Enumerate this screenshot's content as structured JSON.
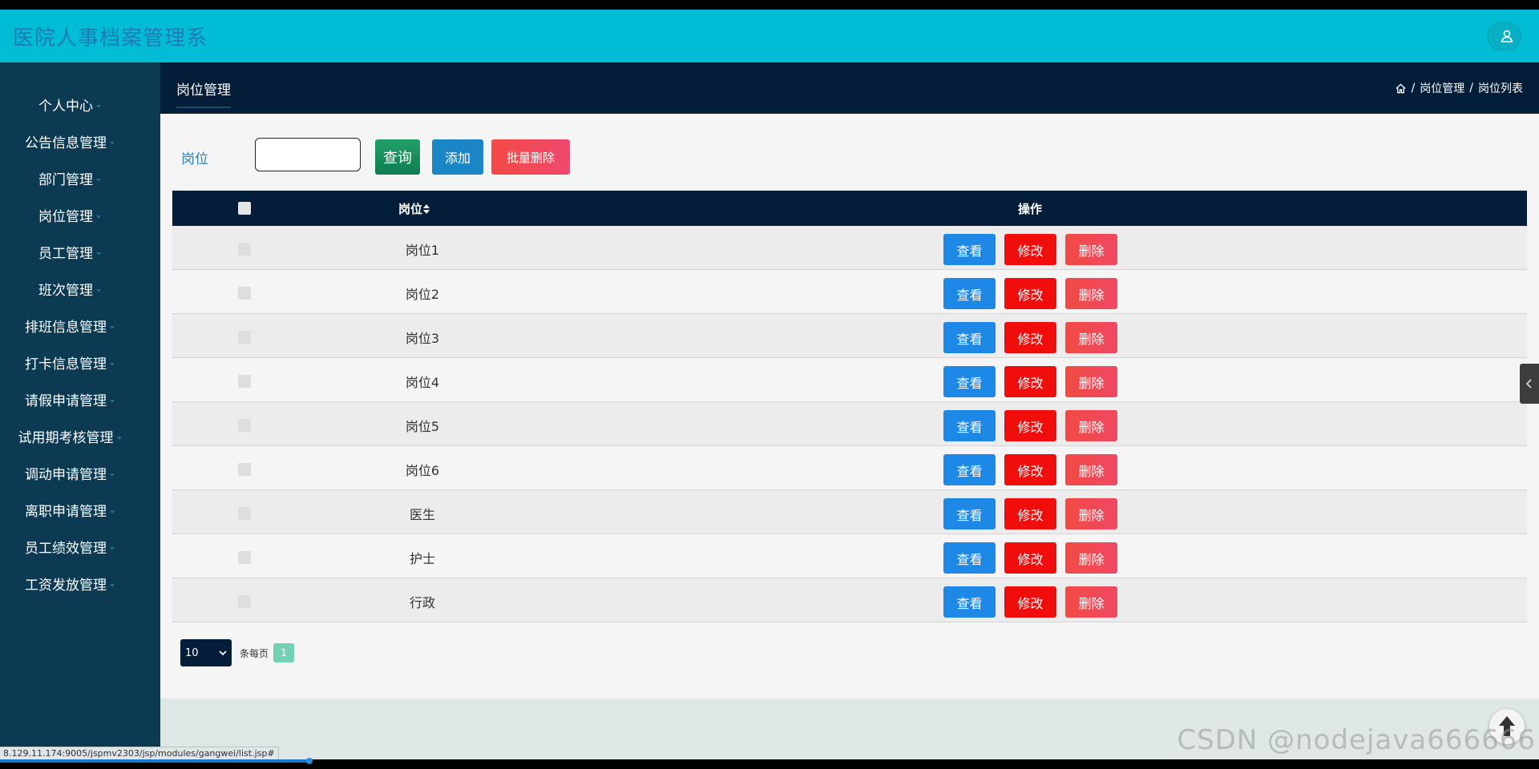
{
  "app": {
    "title": "医院人事档案管理系"
  },
  "sidebar": {
    "items": [
      {
        "label": "个人中心"
      },
      {
        "label": "公告信息管理"
      },
      {
        "label": "部门管理"
      },
      {
        "label": "岗位管理"
      },
      {
        "label": "员工管理"
      },
      {
        "label": "班次管理"
      },
      {
        "label": "排班信息管理"
      },
      {
        "label": "打卡信息管理"
      },
      {
        "label": "请假申请管理"
      },
      {
        "label": "试用期考核管理"
      },
      {
        "label": "调动申请管理"
      },
      {
        "label": "离职申请管理"
      },
      {
        "label": "员工绩效管理"
      },
      {
        "label": "工资发放管理"
      }
    ]
  },
  "page": {
    "title": "岗位管理"
  },
  "breadcrumb": {
    "sep": "/",
    "item1": "岗位管理",
    "item2": "岗位列表"
  },
  "search": {
    "label": "岗位",
    "value": "",
    "placeholder": ""
  },
  "toolbar": {
    "query": "查询",
    "add": "添加",
    "batch_delete": "批量删除"
  },
  "table": {
    "headers": {
      "position": "岗位",
      "ops": "操作"
    },
    "rows": [
      {
        "position": "岗位1"
      },
      {
        "position": "岗位2"
      },
      {
        "position": "岗位3"
      },
      {
        "position": "岗位4"
      },
      {
        "position": "岗位5"
      },
      {
        "position": "岗位6"
      },
      {
        "position": "医生"
      },
      {
        "position": "护士"
      },
      {
        "position": "行政"
      }
    ],
    "actions": {
      "view": "查看",
      "edit": "修改",
      "delete": "删除"
    }
  },
  "pagination": {
    "page_size": "10",
    "per_page_label": "条每页",
    "current_page": "1"
  },
  "status_bar": {
    "url": "8.129.11.174:9005/jspmv2303/jsp/modules/gangwei/list.jsp#"
  },
  "watermark": "CSDN @nodejava666666",
  "colors": {
    "topbar": "#00bcd4",
    "sidebar": "#0b3a52",
    "header_dark": "#041e3a",
    "view_button": "#1d88e5",
    "edit_button": "#f20d0d",
    "delete_button": "#f0485a"
  },
  "icons": [
    "fullscreen-icon",
    "user-icon",
    "home-icon",
    "sort-icon",
    "chevron-down-icon",
    "chevron-left-icon",
    "arrow-up-icon"
  ]
}
